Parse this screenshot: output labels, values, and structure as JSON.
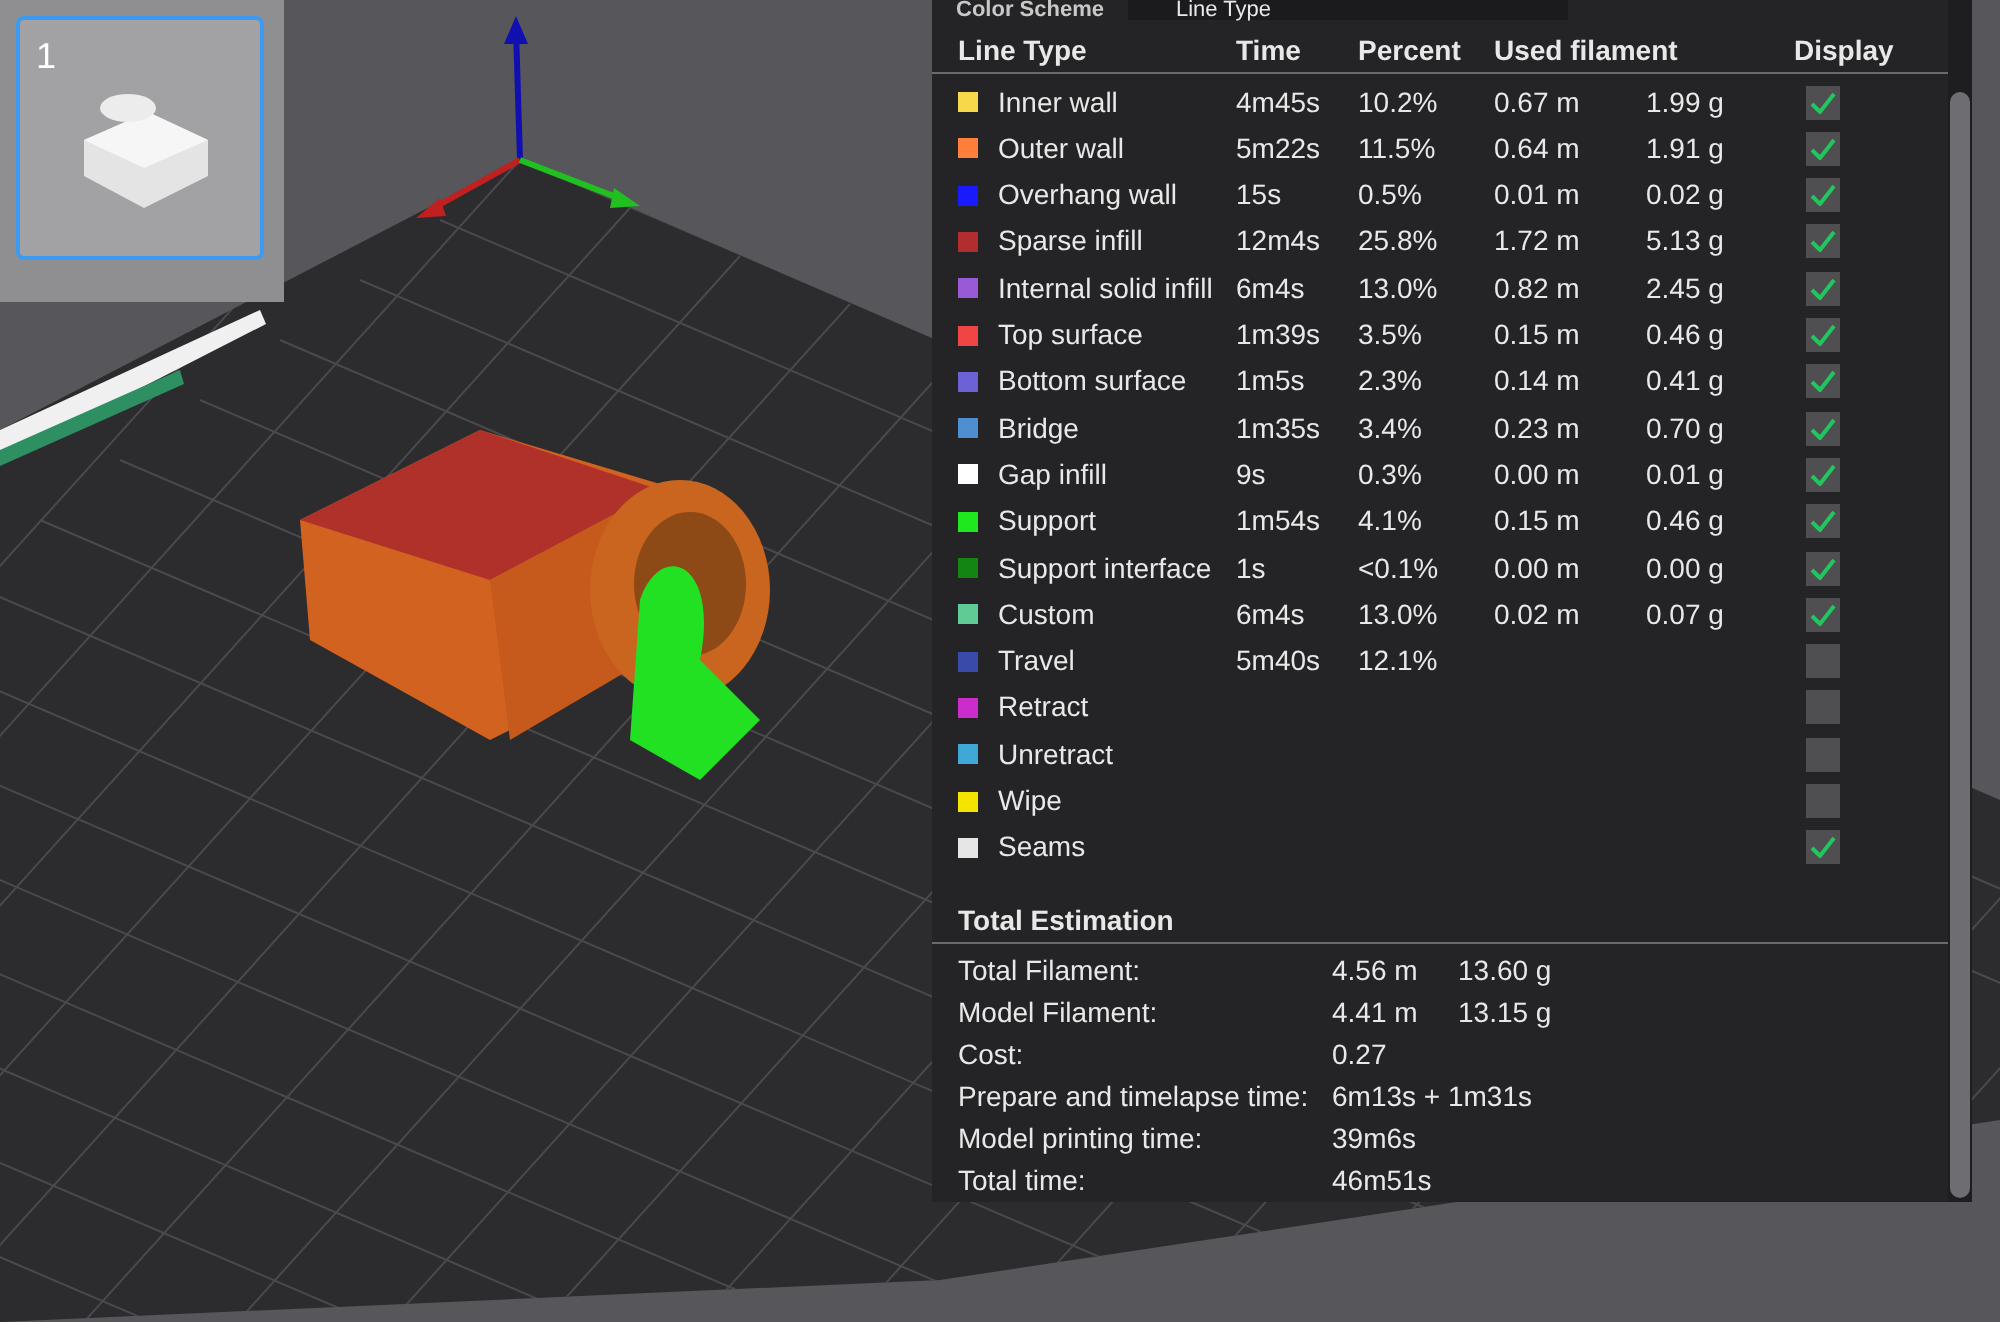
{
  "plate_thumbnail": {
    "label": "1",
    "selected": true
  },
  "color_scheme": {
    "label": "Color Scheme",
    "value": "Line Type"
  },
  "table": {
    "columns": [
      "Line Type",
      "Time",
      "Percent",
      "Used filament",
      "Display"
    ],
    "rows": [
      {
        "name": "Inner wall",
        "color": "#f7d84a",
        "time": "4m45s",
        "percent": "10.2%",
        "length": "0.67 m",
        "weight": "1.99 g",
        "display": true
      },
      {
        "name": "Outer wall",
        "color": "#ff7f3a",
        "time": "5m22s",
        "percent": "11.5%",
        "length": "0.64 m",
        "weight": "1.91 g",
        "display": true
      },
      {
        "name": "Overhang wall",
        "color": "#1a1aff",
        "time": "15s",
        "percent": "0.5%",
        "length": "0.01 m",
        "weight": "0.02 g",
        "display": true
      },
      {
        "name": "Sparse infill",
        "color": "#b22e2e",
        "time": "12m4s",
        "percent": "25.8%",
        "length": "1.72 m",
        "weight": "5.13 g",
        "display": true
      },
      {
        "name": "Internal solid infill",
        "color": "#9a59d6",
        "time": "6m4s",
        "percent": "13.0%",
        "length": "0.82 m",
        "weight": "2.45 g",
        "display": true
      },
      {
        "name": "Top surface",
        "color": "#f04545",
        "time": "1m39s",
        "percent": "3.5%",
        "length": "0.15 m",
        "weight": "0.46 g",
        "display": true
      },
      {
        "name": "Bottom surface",
        "color": "#6b62d6",
        "time": "1m5s",
        "percent": "2.3%",
        "length": "0.14 m",
        "weight": "0.41 g",
        "display": true
      },
      {
        "name": "Bridge",
        "color": "#4f8fd0",
        "time": "1m35s",
        "percent": "3.4%",
        "length": "0.23 m",
        "weight": "0.70 g",
        "display": true
      },
      {
        "name": "Gap infill",
        "color": "#ffffff",
        "time": "9s",
        "percent": "0.3%",
        "length": "0.00 m",
        "weight": "0.01 g",
        "display": true
      },
      {
        "name": "Support",
        "color": "#1fe81f",
        "time": "1m54s",
        "percent": "4.1%",
        "length": "0.15 m",
        "weight": "0.46 g",
        "display": true
      },
      {
        "name": "Support interface",
        "color": "#128512",
        "time": "1s",
        "percent": "<0.1%",
        "length": "0.00 m",
        "weight": "0.00 g",
        "display": true
      },
      {
        "name": "Custom",
        "color": "#5ecc94",
        "time": "6m4s",
        "percent": "13.0%",
        "length": "0.02 m",
        "weight": "0.07 g",
        "display": true
      },
      {
        "name": "Travel",
        "color": "#3a4aa8",
        "time": "5m40s",
        "percent": "12.1%",
        "display": false
      },
      {
        "name": "Retract",
        "color": "#cc2ccc",
        "display": false
      },
      {
        "name": "Unretract",
        "color": "#3fa8d6",
        "display": false
      },
      {
        "name": "Wipe",
        "color": "#f5e400",
        "display": false
      },
      {
        "name": "Seams",
        "color": "#e6e6e6",
        "display": true
      }
    ]
  },
  "total_estimation": {
    "title": "Total Estimation",
    "rows": [
      {
        "label": "Total Filament:",
        "values": [
          "4.56 m",
          "13.60 g"
        ]
      },
      {
        "label": "Model Filament:",
        "values": [
          "4.41 m",
          "13.15 g"
        ]
      },
      {
        "label": "Cost:",
        "values": [
          "0.27"
        ]
      },
      {
        "label": "Prepare and timelapse time:",
        "values": [
          "6m13s + 1m31s"
        ]
      },
      {
        "label": "Model printing time:",
        "values": [
          "39m6s"
        ]
      },
      {
        "label": "Total time:",
        "values": [
          "46m51s"
        ]
      }
    ]
  }
}
